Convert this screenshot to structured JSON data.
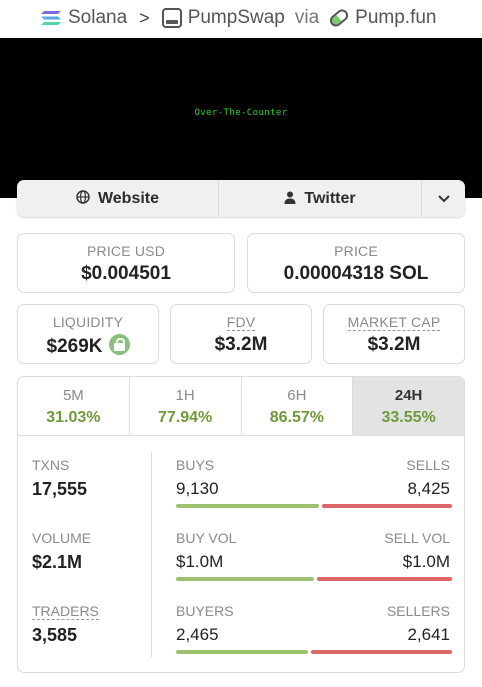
{
  "breadcrumb": {
    "chain": "Solana",
    "dex": "PumpSwap",
    "via": "via",
    "launchpad": "Pump.fun"
  },
  "banner": {
    "text": "Over-The-Counter"
  },
  "links": {
    "website": "Website",
    "twitter": "Twitter"
  },
  "stats": {
    "price_usd": {
      "label": "PRICE USD",
      "value": "$0.004501"
    },
    "price": {
      "label": "PRICE",
      "value": "0.00004318 SOL"
    },
    "liquidity": {
      "label": "LIQUIDITY",
      "value": "$269K"
    },
    "fdv": {
      "label": "FDV",
      "value": "$3.2M"
    },
    "market_cap": {
      "label": "MARKET CAP",
      "value": "$3.2M"
    }
  },
  "timeframes": [
    {
      "label": "5M",
      "change": "31.03%"
    },
    {
      "label": "1H",
      "change": "77.94%"
    },
    {
      "label": "6H",
      "change": "86.57%"
    },
    {
      "label": "24H",
      "change": "33.55%",
      "active": true
    }
  ],
  "activity": {
    "txns": {
      "label": "TXNS",
      "value": "17,555"
    },
    "buys": {
      "label": "BUYS",
      "value": "9,130"
    },
    "sells": {
      "label": "SELLS",
      "value": "8,425"
    },
    "volume": {
      "label": "VOLUME",
      "value": "$2.1M"
    },
    "buy_vol": {
      "label": "BUY VOL",
      "value": "$1.0M"
    },
    "sell_vol": {
      "label": "SELL VOL",
      "value": "$1.0M"
    },
    "traders": {
      "label": "TRADERS",
      "value": "3,585"
    },
    "buyers": {
      "label": "BUYERS",
      "value": "2,465"
    },
    "sellers": {
      "label": "SELLERS",
      "value": "2,641"
    }
  },
  "ratios": {
    "buys_share": 0.52,
    "buy_vol_share": 0.5,
    "buyers_share": 0.483
  },
  "colors": {
    "positive": "#6f9a3b",
    "buy_bar": "#9dc16f",
    "sell_bar": "#dc6766",
    "banner_text": "#35d12c"
  }
}
